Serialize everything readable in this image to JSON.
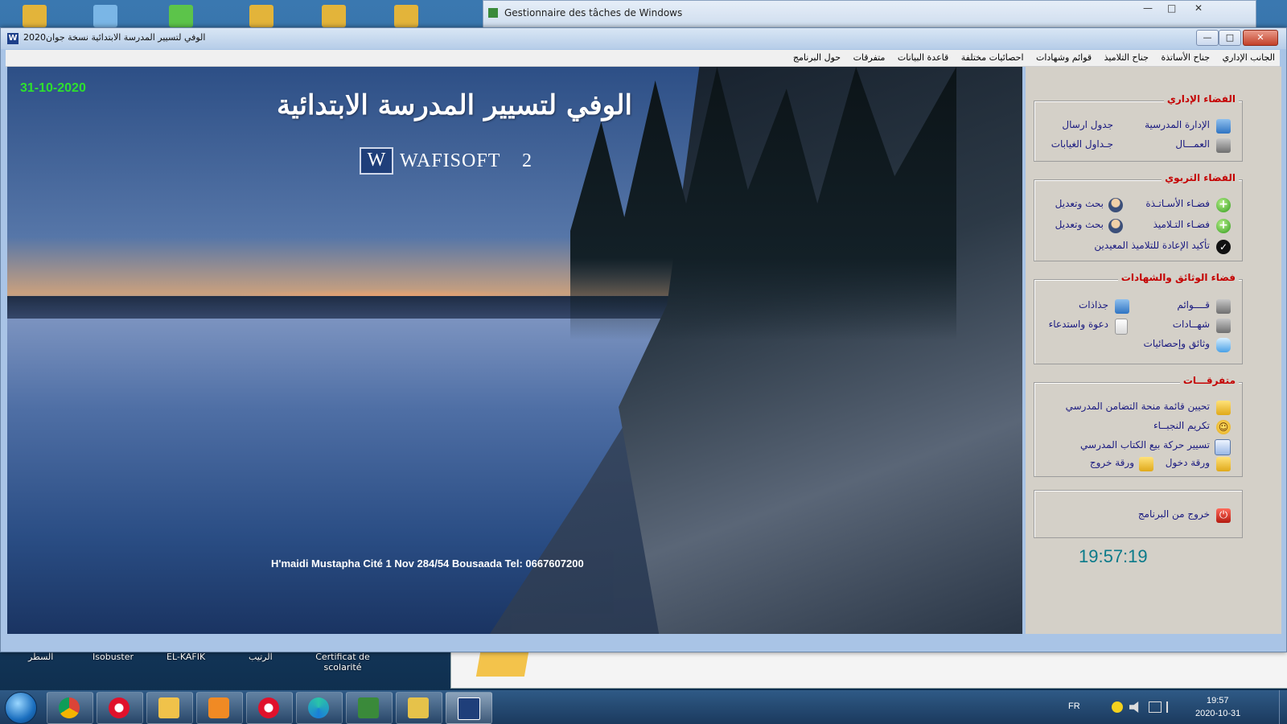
{
  "background_window": {
    "title": "Gestionnaire des tâches de Windows"
  },
  "desktop_labels": [
    "السطر",
    "Isobuster",
    "EL-KAFIK",
    "الرتيب",
    "Certificat de scolarité"
  ],
  "app": {
    "title": "الوفي لتسيير المدرسة الابتدائية نسخة جوان2020",
    "icon_letter": "W",
    "controls": {
      "minimize": "—",
      "maximize": "□",
      "close": "✕"
    }
  },
  "menu": [
    "الجانب الإداري",
    "جناح الأساتذة",
    "جناح التلاميذ",
    "قوائم وشهادات",
    "احصائيات مختلفة",
    "قاعدة البيانات",
    "متفرقات",
    "حول البرنامج"
  ],
  "hero": {
    "date": "31-10-2020",
    "title": "الوفي لتسيير المدرسة الابتدائية",
    "brand_logo": "W",
    "brand_name": "WAFISOFT",
    "brand_version": "2",
    "footer": "H'maidi Mustapha Cité 1 Nov 284/54 Bousaada Tel: 0667607200"
  },
  "panel": {
    "admin": {
      "title": "الفضاء الإداري",
      "items": [
        "الإدارة المدرسية",
        "جدول ارسال",
        "العمـــال",
        "جـداول الغيابات"
      ]
    },
    "educational": {
      "title": "الفضاء التربوي",
      "items": [
        "فضـاء الأسـاتـذة",
        "بحث وتعديل",
        "فضـاء التـلاميذ",
        "بحث وتعديل",
        "تأكيد الإعادة للتلاميذ المعيدين"
      ]
    },
    "documents": {
      "title": "فضاء الوثائق والشهادات",
      "items": [
        "قــــوائم",
        "جذاذات",
        "شهــادات",
        "دعوة واستدعاء",
        "وثائق وإحصائيات"
      ]
    },
    "misc": {
      "title": "متفرقـــات",
      "items": [
        "تحيين قائمة منحة التضامن المدرسي",
        "تكريم النجبــاء",
        "تسيير حركة بيع الكتاب المدرسي",
        "ورقة دخول",
        "ورقة خروج"
      ]
    },
    "exit_label": "خروج من البرنامج",
    "clock": "19:57:19"
  },
  "taskbar": {
    "lang": "FR",
    "time": "19:57",
    "date": "2020-10-31"
  },
  "colors": {
    "panel_bg": "#d4d0c8",
    "group_title": "#c40000",
    "item_text": "#1a1a80",
    "date_green": "#2ee02e",
    "clock": "#0a7a8a"
  }
}
